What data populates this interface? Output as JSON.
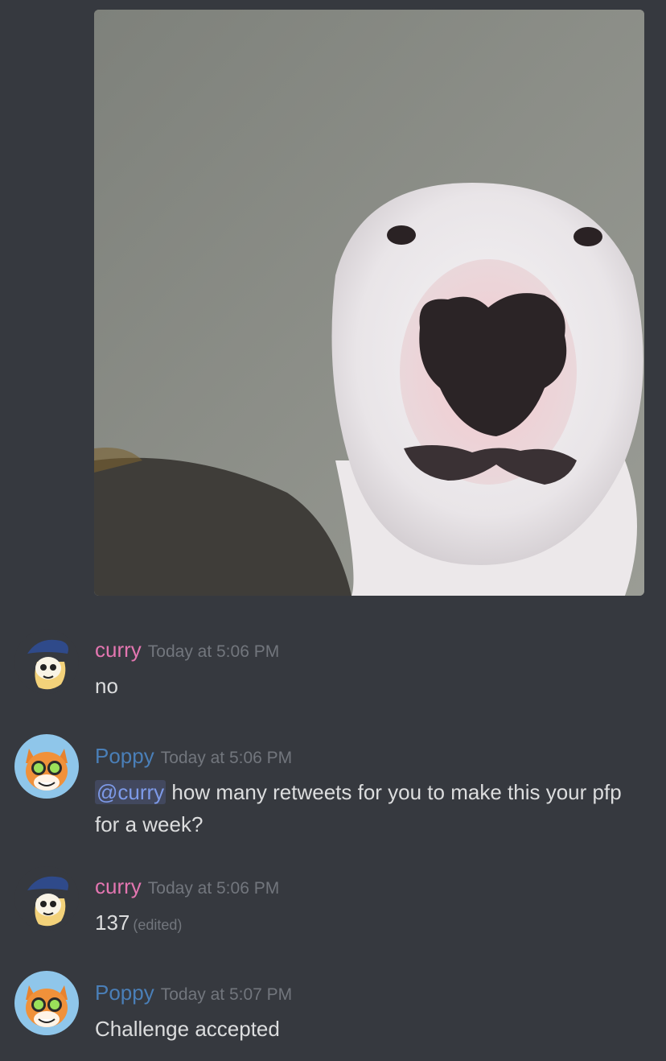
{
  "attachment": {
    "image_description_icon": "dog-photo-icon"
  },
  "messages": [
    {
      "author": "curry",
      "author_color": "#e476b1",
      "timestamp": "Today at 5:06 PM",
      "text": "no",
      "avatar_icon": "curry-avatar-icon"
    },
    {
      "author": "Poppy",
      "author_color": "#4a7fb8",
      "timestamp": "Today at 5:06 PM",
      "mention": "@curry",
      "text": " how many retweets for you to make this your pfp for a week?",
      "avatar_icon": "poppy-avatar-icon"
    },
    {
      "author": "curry",
      "author_color": "#e476b1",
      "timestamp": "Today at 5:06 PM",
      "text": "137",
      "edited_label": "(edited)",
      "avatar_icon": "curry-avatar-icon"
    },
    {
      "author": "Poppy",
      "author_color": "#4a7fb8",
      "timestamp": "Today at 5:07 PM",
      "text": "Challenge accepted",
      "avatar_icon": "poppy-avatar-icon"
    }
  ]
}
